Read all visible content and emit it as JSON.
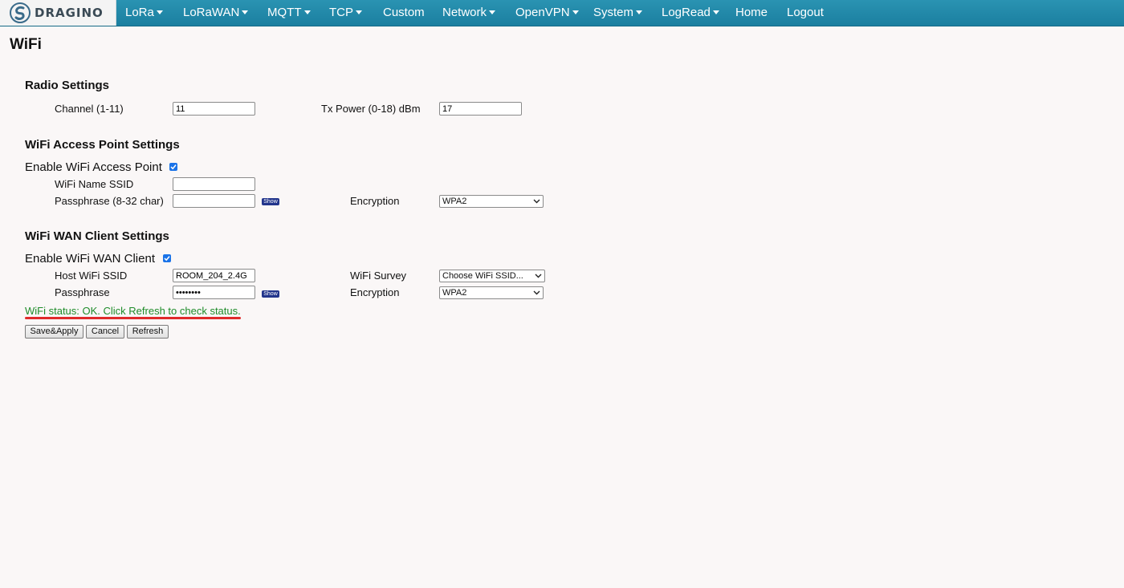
{
  "brand": {
    "logo_text": "DRAGINO"
  },
  "nav": {
    "items": [
      {
        "label": "LoRa",
        "has_menu": true
      },
      {
        "label": "LoRaWAN",
        "has_menu": true
      },
      {
        "label": "MQTT",
        "has_menu": true
      },
      {
        "label": "TCP",
        "has_menu": true
      },
      {
        "label": "Custom",
        "has_menu": false
      },
      {
        "label": "Network",
        "has_menu": true
      },
      {
        "label": "OpenVPN",
        "has_menu": true
      },
      {
        "label": "System",
        "has_menu": true
      },
      {
        "label": "LogRead",
        "has_menu": true
      },
      {
        "label": "Home",
        "has_menu": false
      },
      {
        "label": "Logout",
        "has_menu": false
      }
    ]
  },
  "page": {
    "title": "WiFi"
  },
  "radio": {
    "title": "Radio Settings",
    "channel_label": "Channel (1-11)",
    "channel_value": "11",
    "txpower_label": "Tx Power (0-18) dBm",
    "txpower_value": "17"
  },
  "ap": {
    "title": "WiFi Access Point Settings",
    "enable_label": "Enable WiFi Access Point",
    "enabled": true,
    "ssid_label": "WiFi Name SSID",
    "ssid_value": "",
    "pass_label": "Passphrase (8-32 char)",
    "pass_value": "",
    "show_label": "Show",
    "enc_label": "Encryption",
    "enc_value": "WPA2"
  },
  "wan": {
    "title": "WiFi WAN Client Settings",
    "enable_label": "Enable WiFi WAN Client",
    "enabled": true,
    "ssid_label": "Host WiFi SSID",
    "ssid_value": "ROOM_204_2.4G",
    "survey_label": "WiFi Survey",
    "survey_value": "Choose WiFi SSID...",
    "pass_label": "Passphrase",
    "pass_value": "••••••••",
    "show_label": "Show",
    "enc_label": "Encryption",
    "enc_value": "WPA2"
  },
  "status_text": "WiFi status: OK. Click Refresh to check status.",
  "buttons": {
    "save": "Save&Apply",
    "cancel": "Cancel",
    "refresh": "Refresh"
  },
  "colors": {
    "nav_bg": "#1f88a8",
    "status_green": "#1f8c2a",
    "annotation_red": "#e02b2b",
    "checkbox_blue": "#1a73e8"
  }
}
